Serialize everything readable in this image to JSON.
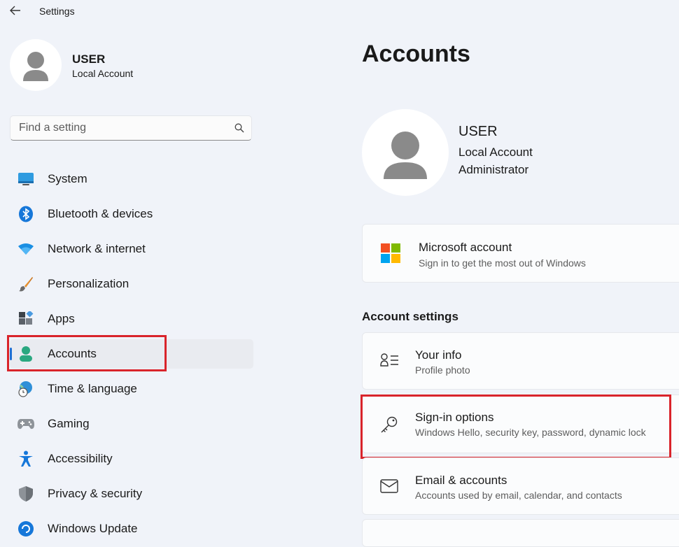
{
  "window": {
    "title": "Settings"
  },
  "sidebar_user": {
    "name": "USER",
    "account_type": "Local Account"
  },
  "search": {
    "placeholder": "Find a setting"
  },
  "nav": {
    "items": [
      {
        "label": "System",
        "icon": "system-icon"
      },
      {
        "label": "Bluetooth & devices",
        "icon": "bluetooth-icon"
      },
      {
        "label": "Network & internet",
        "icon": "wifi-icon"
      },
      {
        "label": "Personalization",
        "icon": "brush-icon"
      },
      {
        "label": "Apps",
        "icon": "apps-icon"
      },
      {
        "label": "Accounts",
        "icon": "person-icon",
        "selected": true
      },
      {
        "label": "Time & language",
        "icon": "globe-clock-icon"
      },
      {
        "label": "Gaming",
        "icon": "gamepad-icon"
      },
      {
        "label": "Accessibility",
        "icon": "accessibility-icon"
      },
      {
        "label": "Privacy & security",
        "icon": "shield-icon"
      },
      {
        "label": "Windows Update",
        "icon": "update-icon"
      }
    ]
  },
  "main": {
    "title": "Accounts",
    "profile": {
      "name": "USER",
      "account_type": "Local Account",
      "role": "Administrator"
    },
    "microsoft_account": {
      "title": "Microsoft account",
      "subtitle": "Sign in to get the most out of Windows"
    },
    "section_heading": "Account settings",
    "settings": [
      {
        "title": "Your info",
        "subtitle": "Profile photo",
        "icon": "your-info-icon"
      },
      {
        "title": "Sign-in options",
        "subtitle": "Windows Hello, security key, password, dynamic lock",
        "icon": "key-icon"
      },
      {
        "title": "Email & accounts",
        "subtitle": "Accounts used by email, calendar, and contacts",
        "icon": "mail-icon"
      }
    ]
  },
  "colors": {
    "accent": "#1f6fd3",
    "highlight": "#d9242b",
    "background": "#f0f3f9"
  }
}
